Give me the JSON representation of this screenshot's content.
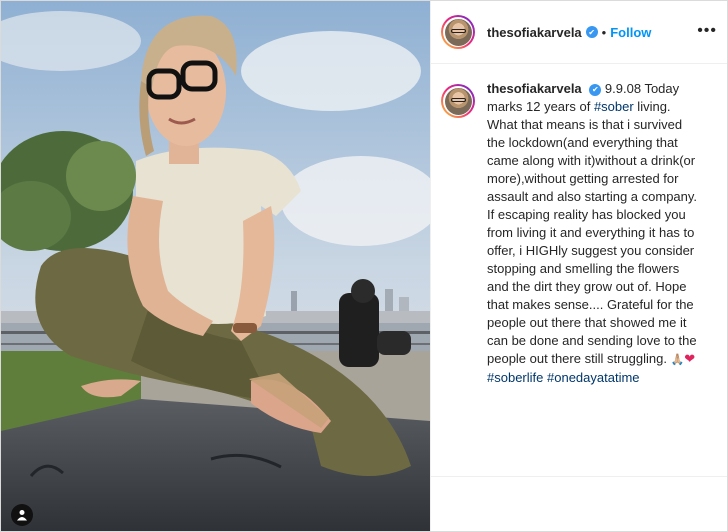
{
  "post": {
    "username": "thesofiakarvela",
    "dot": "•",
    "follow_label": "Follow",
    "more_label": "•••",
    "verified_glyph": "✔",
    "caption": {
      "date": "9.9.08",
      "p1": " Today marks 12 years of ",
      "tag_sober": "#sober",
      "p2": " living. What that means is that i survived the lockdown(and everything that came along with it)without a drink(or more),without getting arrested for assault and also starting a company. If escaping reality has blocked you from living it and everything it has to offer, i HIGHly suggest you consider stopping and smelling the flowers and the dirt they grow out of. Hope that makes sense.... Grateful for the people out there that showed me it can be done and sending love to the people out there still struggling. ",
      "emoji_pray": "🙏🏼",
      "emoji_heart": "❤",
      "tag_soberlife": "#soberlife",
      "tag_oneday": "#onedayatatime"
    },
    "icons": {
      "verified": "verified-badge-icon",
      "user_tag": "user-tag-icon",
      "more": "more-options-icon"
    },
    "colors": {
      "accent": "#0095f6",
      "verified": "#3897f0",
      "hashtag": "#00376b"
    }
  }
}
